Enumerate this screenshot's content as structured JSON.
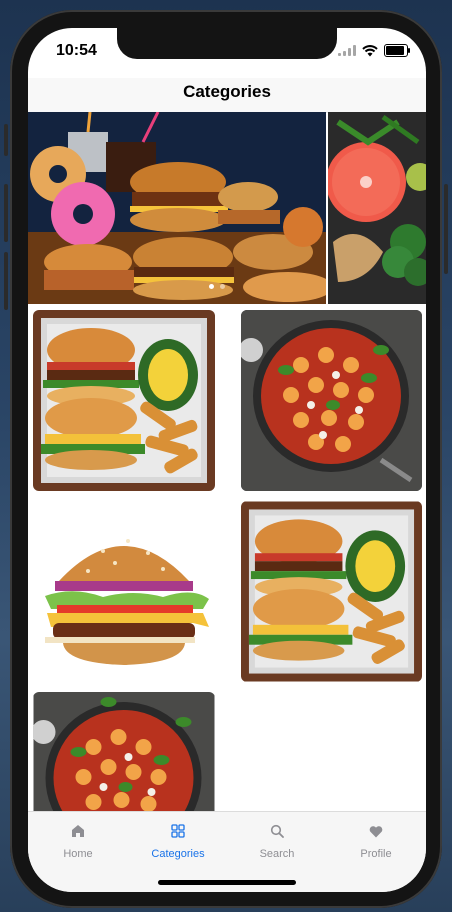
{
  "status_bar": {
    "time": "10:54"
  },
  "header": {
    "title": "Categories"
  },
  "carousel": {
    "slides": [
      "fast-food",
      "vegetables"
    ],
    "active_index": 0
  },
  "tabs": [
    {
      "label": "Home",
      "icon": "home-icon",
      "active": false
    },
    {
      "label": "Categories",
      "icon": "grid-icon",
      "active": true
    },
    {
      "label": "Search",
      "icon": "search-icon",
      "active": false
    },
    {
      "label": "Profile",
      "icon": "heart-icon",
      "active": false
    }
  ],
  "colors": {
    "accent": "#1a73e8",
    "inactive": "#8e8e93"
  }
}
